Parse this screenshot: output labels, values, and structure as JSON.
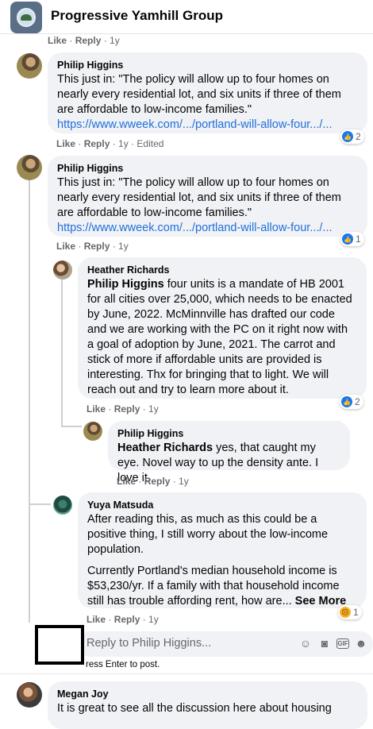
{
  "group": {
    "name": "Progressive Yamhill Group"
  },
  "top_strip": {
    "like": "Like",
    "reply": "Reply",
    "time": "1y"
  },
  "comments": [
    {
      "author": "Philip Higgins",
      "text": "This just in: \"The policy will allow up to four homes on nearly every residential lot, and six units if three of them are affordable to low-income families.\"",
      "link": "https://www.wweek.com/.../portland-will-allow-four.../...",
      "like": "Like",
      "reply": "Reply",
      "time": "1y",
      "edited": "Edited",
      "reactions": "2"
    },
    {
      "author": "Philip Higgins",
      "text": "This just in: \"The policy will allow up to four homes on nearly every residential lot, and six units if three of them are affordable to low-income families.\"",
      "link": "https://www.wweek.com/.../portland-will-allow-four.../...",
      "like": "Like",
      "reply": "Reply",
      "time": "1y",
      "reactions": "1"
    }
  ],
  "replies": [
    {
      "author": "Heather Richards",
      "mention": "Philip Higgins",
      "text": " four units is a mandate of HB 2001 for all cities over 25,000, which needs to be enacted by June, 2022. McMinnville has drafted our code and we are working with the PC on it right now with a goal of adoption by June, 2021. The carrot and stick of more if affordable units are provided is interesting. Thx for bringing that to light. We will reach out and try to learn more about it.",
      "like": "Like",
      "reply": "Reply",
      "time": "1y",
      "reactions": "2"
    },
    {
      "author": "Philip Higgins",
      "mention": "Heather Richards",
      "text": " yes, that caught my eye. Novel way to up the density ante. I love it.",
      "like": "Like",
      "reply": "Reply",
      "time": "1y"
    },
    {
      "author": "Yuya Matsuda",
      "text1": "After reading this, as much as this could be a positive thing, I still worry about the low-income population.",
      "text2": "Currently Portland's median household income is $53,230/yr. If a family with that household income still has trouble affording rent, how are...",
      "see_more": " See More",
      "like": "Like",
      "reply": "Reply",
      "time": "1y",
      "reactions": "1"
    }
  ],
  "reply_box": {
    "placeholder": "Reply to Philip Higgins...",
    "hint": "ress Enter to post."
  },
  "next_comment": {
    "author": "Megan Joy",
    "text": "It is great to see all the discussion here about housing"
  },
  "colors": {
    "link": "#216fdb",
    "bubble": "#f0f2f5",
    "like_blue": "#1877f2",
    "meta": "#65676b"
  },
  "icons": [
    "emoji-icon",
    "camera-icon",
    "gif-icon",
    "sticker-icon"
  ]
}
